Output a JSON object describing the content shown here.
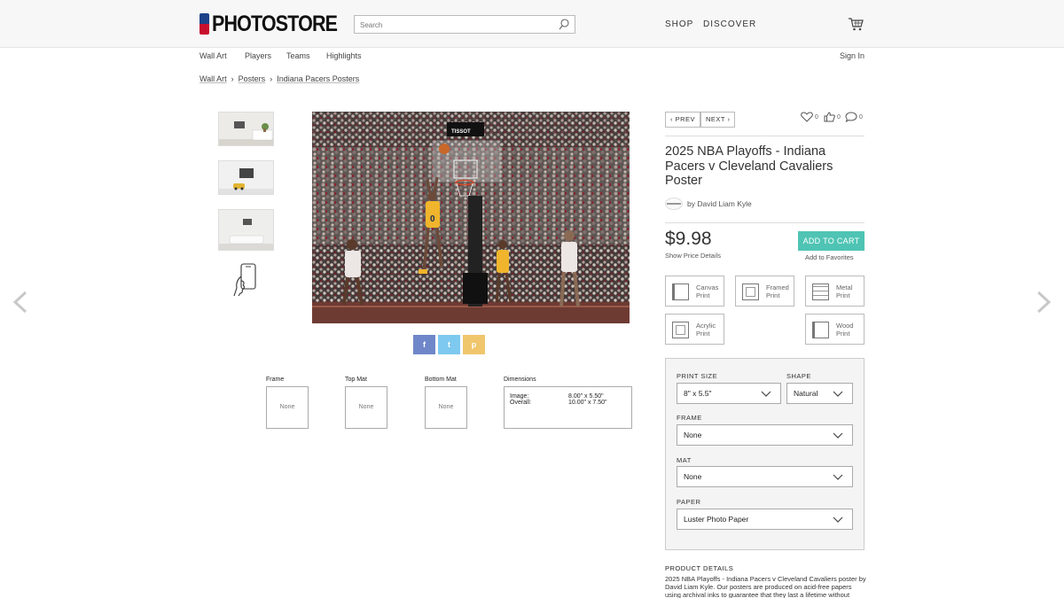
{
  "header": {
    "logo_text": "PHOTOSTORE",
    "search_placeholder": "Search",
    "nav": [
      "SHOP",
      "DISCOVER"
    ]
  },
  "subnav": {
    "items": [
      "Wall Art",
      "Players",
      "Teams",
      "Highlights"
    ],
    "sign_in": "Sign In"
  },
  "breadcrumb": [
    "Wall Art",
    "Posters",
    "Indiana Pacers Posters"
  ],
  "product": {
    "prev_label": "PREV",
    "next_label": "NEXT",
    "favorites_count": "0",
    "likes_count": "0",
    "comments_count": "0",
    "title": "2025 NBA Playoffs - Indiana Pacers v Cleveland Cavaliers Poster",
    "artist": "by David Liam Kyle",
    "price": "$9.98",
    "price_details": "Show Price Details",
    "add_to_cart": "ADD TO CART",
    "add_to_favorites": "Add to Favorites",
    "print_types": [
      {
        "line1": "Canvas",
        "line2": "Print"
      },
      {
        "line1": "Framed",
        "line2": "Print"
      },
      {
        "line1": "Metal",
        "line2": "Print"
      },
      {
        "line1": "Acrylic",
        "line2": "Print"
      },
      {
        "line1": "Wood",
        "line2": "Print"
      }
    ]
  },
  "photo": {
    "scoreboard_text": "TISSOT",
    "jersey_number": "0"
  },
  "share": {
    "facebook": "f",
    "twitter": "t",
    "pinterest": "p"
  },
  "options_preview": {
    "frame_label": "Frame",
    "frame_value": "None",
    "topmat_label": "Top Mat",
    "topmat_value": "None",
    "bottommat_label": "Bottom Mat",
    "bottommat_value": "None",
    "dimensions_label": "Dimensions",
    "image_label": "Image:",
    "image_value": "8.00\" x 5.50\"",
    "overall_label": "Overall:",
    "overall_value": "10.00\" x 7.50\""
  },
  "config": {
    "print_size_label": "PRINT SIZE",
    "print_size_value": "8\" x 5.5\"",
    "shape_label": "SHAPE",
    "shape_value": "Natural",
    "frame_label": "FRAME",
    "frame_value": "None",
    "mat_label": "MAT",
    "mat_value": "None",
    "paper_label": "PAPER",
    "paper_value": "Luster Photo Paper"
  },
  "product_details": {
    "heading": "PRODUCT DETAILS",
    "text": "2025 NBA Playoffs - Indiana Pacers v Cleveland Cavaliers poster by David Liam Kyle.  Our posters are produced on acid-free papers using archival inks to guarantee that they last a lifetime without"
  },
  "colors": {
    "accent": "#4fc4b4",
    "facebook": "#6f87c9",
    "twitter": "#7dc9ef",
    "pinterest": "#f0c66c"
  }
}
